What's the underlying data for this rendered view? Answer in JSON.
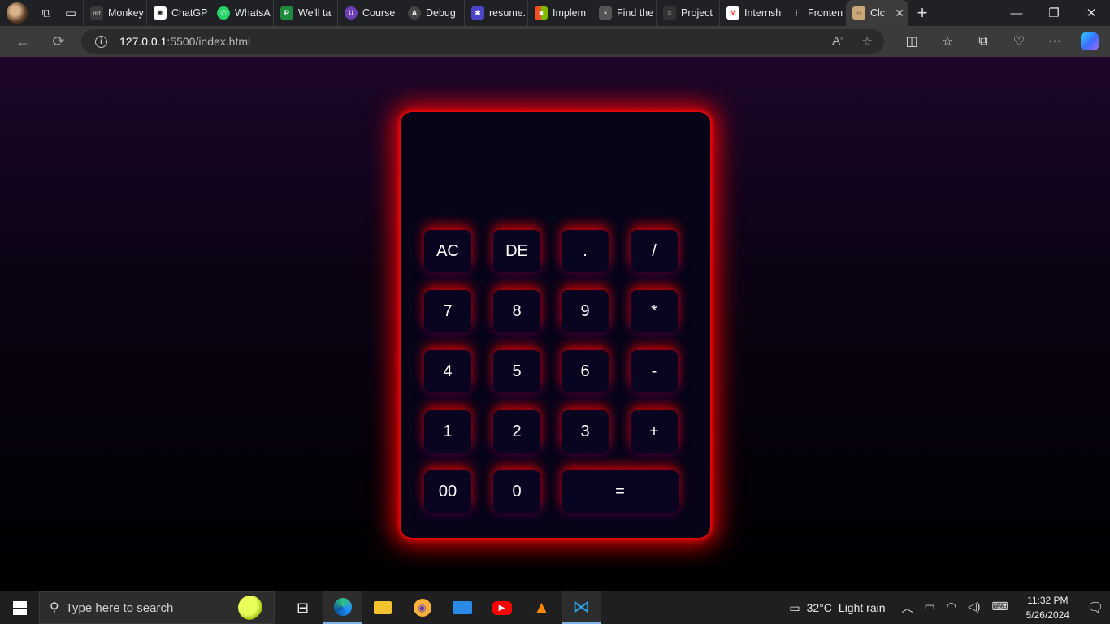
{
  "browser": {
    "tabs": [
      {
        "label": "Monkey",
        "fav": "mt",
        "color": "#3a3a3a"
      },
      {
        "label": "ChatGP",
        "fav": "✺",
        "color": "#ffffff"
      },
      {
        "label": "WhatsA",
        "fav": "✆",
        "color": "#25d366"
      },
      {
        "label": "We'll ta",
        "fav": "R",
        "color": "#1e8a3e"
      },
      {
        "label": "Course",
        "fav": "U",
        "color": "#6b3fb3"
      },
      {
        "label": "Debug",
        "fav": "A",
        "color": "#444444"
      },
      {
        "label": "resume.",
        "fav": "✱",
        "color": "#4a45c9"
      },
      {
        "label": "Implem",
        "fav": "■",
        "color": "#e06a1b"
      },
      {
        "label": "Find the",
        "fav": "⚡",
        "color": "#555555"
      },
      {
        "label": "Project",
        "fav": "≈",
        "color": "#333333"
      },
      {
        "label": "Internsh",
        "fav": "M",
        "color": "#d93025"
      },
      {
        "label": "Fronten",
        "fav": "⋮",
        "color": "#202124"
      },
      {
        "label": "Clc",
        "fav": "☼",
        "color": "#caa878",
        "active": true
      }
    ],
    "url_host": "127.0.0.1",
    "url_path": ":5500/index.html"
  },
  "calculator": {
    "display_value": "",
    "keys": [
      {
        "label": "AC",
        "value": "AC"
      },
      {
        "label": "DE",
        "value": "DE"
      },
      {
        "label": ".",
        "value": "."
      },
      {
        "label": "/",
        "value": "/"
      },
      {
        "label": "7",
        "value": "7"
      },
      {
        "label": "8",
        "value": "8"
      },
      {
        "label": "9",
        "value": "9"
      },
      {
        "label": "*",
        "value": "*"
      },
      {
        "label": "4",
        "value": "4"
      },
      {
        "label": "5",
        "value": "5"
      },
      {
        "label": "6",
        "value": "6"
      },
      {
        "label": "-",
        "value": "-"
      },
      {
        "label": "1",
        "value": "1"
      },
      {
        "label": "2",
        "value": "2"
      },
      {
        "label": "3",
        "value": "3"
      },
      {
        "label": "+",
        "value": "+"
      },
      {
        "label": "00",
        "value": "00"
      },
      {
        "label": "0",
        "value": "0"
      },
      {
        "label": "=",
        "value": "="
      }
    ]
  },
  "taskbar": {
    "search_placeholder": "Type here to search",
    "weather_temp": "32°C",
    "weather_desc": "Light rain",
    "time": "11:32 PM",
    "date": "5/26/2024"
  }
}
